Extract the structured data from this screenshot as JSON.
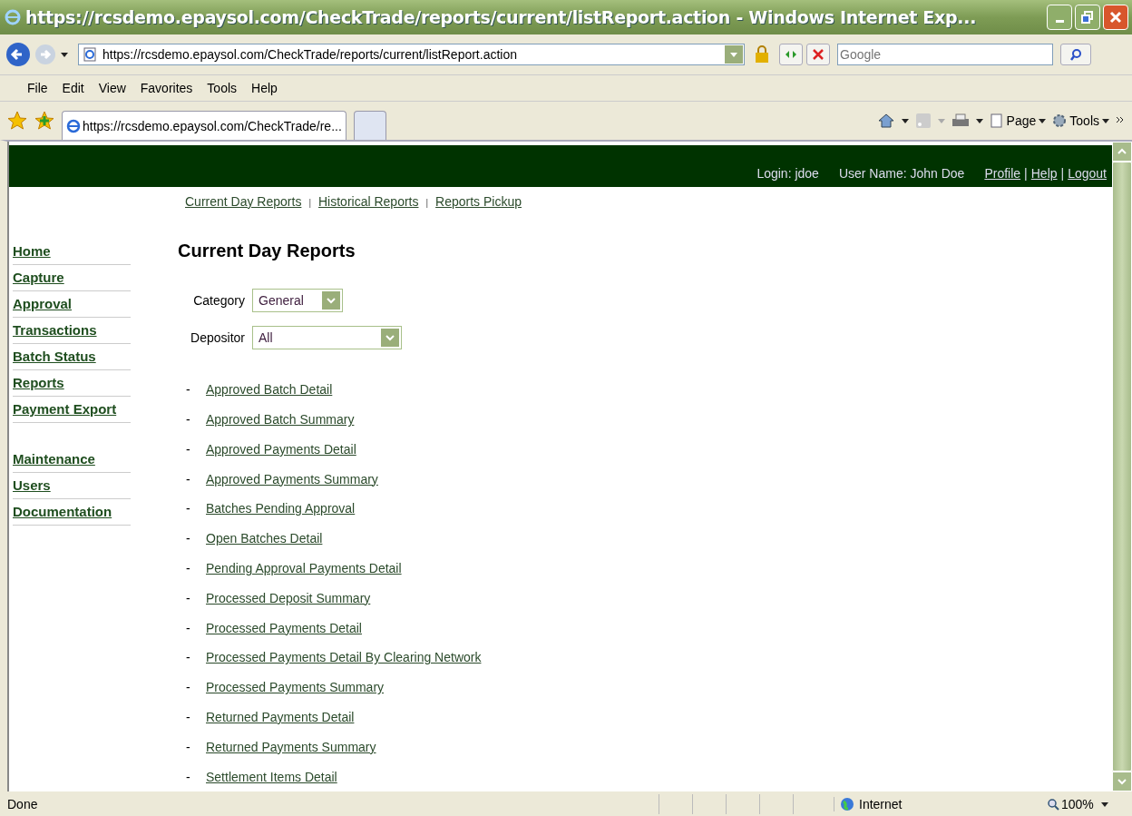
{
  "window": {
    "title": "https://rcsdemo.epaysol.com/CheckTrade/reports/current/listReport.action - Windows Internet Exp..."
  },
  "address_bar": {
    "url": "https://rcsdemo.epaysol.com/CheckTrade/reports/current/listReport.action",
    "search_placeholder": "Google"
  },
  "menu": [
    "File",
    "Edit",
    "View",
    "Favorites",
    "Tools",
    "Help"
  ],
  "tabs": [
    {
      "label": "https://rcsdemo.epaysol.com/CheckTrade/re...",
      "selected": true
    },
    {
      "selected": false
    }
  ],
  "command_bar": [
    "Page",
    "Tools"
  ],
  "header": {
    "login": "Login: jdoe",
    "user_name": "User Name: John Doe",
    "links": [
      {
        "label": "Profile"
      },
      {
        "separator": "|",
        "label": "Help"
      },
      {
        "separator": "|",
        "label": "Logout"
      }
    ]
  },
  "sub_nav": [
    {
      "label": "Current Day Reports"
    },
    {
      "separator": "|",
      "label": "Historical Reports"
    },
    {
      "separator": "|",
      "label": "Reports Pickup"
    }
  ],
  "sidebar": {
    "groups": [
      [
        "Home",
        "Capture",
        "Approval",
        "Transactions",
        "Batch Status",
        "Reports",
        "Payment Export"
      ],
      [
        "Maintenance",
        "Users",
        "Documentation"
      ]
    ]
  },
  "page_title": "Current Day Reports",
  "filters": [
    {
      "label": "Category",
      "value": "General",
      "kind": "short"
    },
    {
      "label": "Depositor",
      "value": "All",
      "kind": "long"
    }
  ],
  "reports": [
    {
      "bullet": "-",
      "label": "Approved Batch Detail"
    },
    {
      "bullet": "-",
      "label": "Approved Batch Summary"
    },
    {
      "bullet": "-",
      "label": "Approved Payments Detail"
    },
    {
      "bullet": "-",
      "label": "Approved Payments Summary"
    },
    {
      "bullet": "-",
      "label": "Batches Pending Approval"
    },
    {
      "bullet": "-",
      "label": "Open Batches Detail"
    },
    {
      "bullet": "-",
      "label": "Pending Approval Payments Detail"
    },
    {
      "bullet": "-",
      "label": "Processed Deposit Summary"
    },
    {
      "bullet": "-",
      "label": "Processed Payments Detail"
    },
    {
      "bullet": "-",
      "label": "Processed Payments Detail By Clearing Network"
    },
    {
      "bullet": "-",
      "label": "Processed Payments Summary"
    },
    {
      "bullet": "-",
      "label": "Returned Payments Detail"
    },
    {
      "bullet": "-",
      "label": "Returned Payments Summary"
    },
    {
      "bullet": "-",
      "label": "Settlement Items Detail"
    }
  ],
  "status_bar": {
    "text": "Done",
    "zone": "Internet",
    "zoom": "100%"
  }
}
